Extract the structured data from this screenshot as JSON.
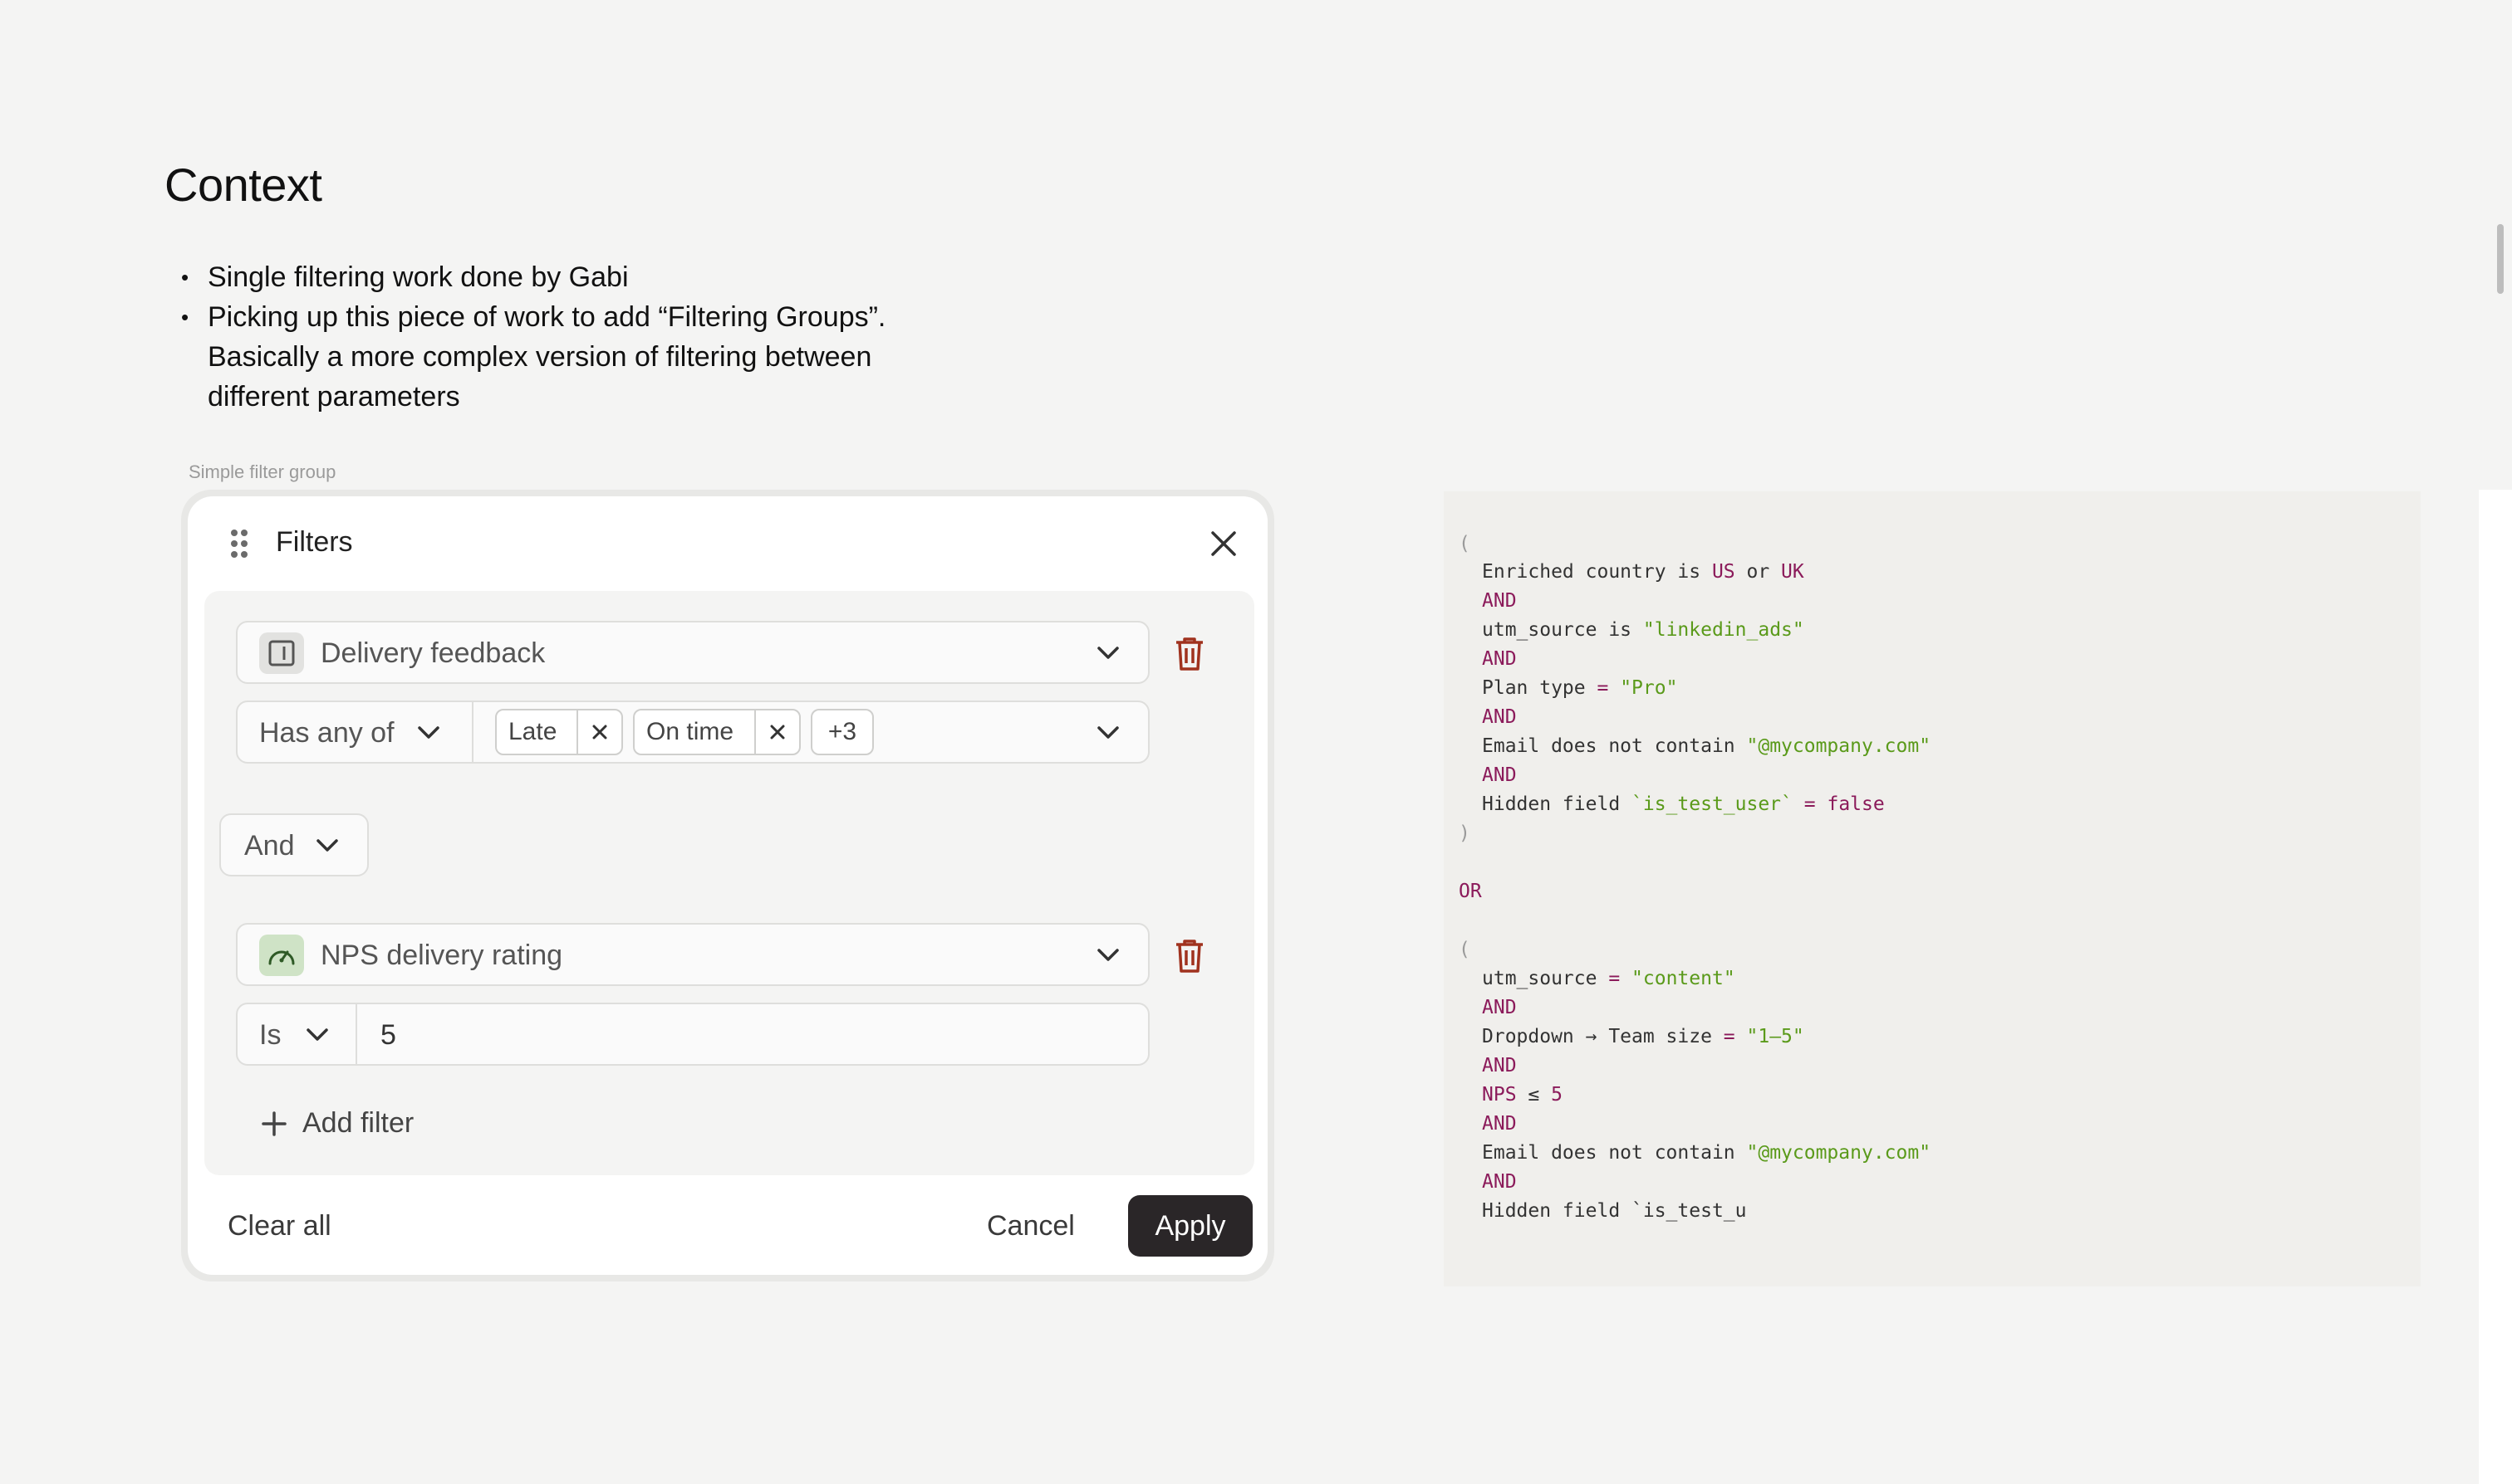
{
  "context": {
    "title": "Context",
    "bullets": [
      "Single filtering work done by Gabi",
      "Picking up this piece of work to add “Filtering Groups”. Basically a more complex version of filtering between different parameters"
    ],
    "group_caption": "Simple filter group"
  },
  "filters_panel": {
    "title": "Filters",
    "icons": {
      "drag": "drag-handle-icon",
      "close": "close-icon",
      "delete": "trash-icon",
      "chevron": "chevron-down-icon",
      "add": "plus-icon"
    },
    "filter1": {
      "field": "Delivery feedback",
      "field_icon": "text-field-icon",
      "operator": "Has any of",
      "tags": [
        "Late",
        "On time"
      ],
      "more": "+3"
    },
    "combinator": "And",
    "filter2": {
      "field": "NPS delivery rating",
      "field_icon": "gauge-icon",
      "operator": "Is",
      "value": "5"
    },
    "add_filter": "Add filter",
    "clear_all": "Clear all",
    "cancel": "Cancel",
    "apply": "Apply"
  },
  "code": {
    "open_paren": "(",
    "close_paren": ")",
    "and": "AND",
    "or": "OR",
    "eq": "=",
    "group1": {
      "l1": {
        "pre": "Enriched country is ",
        "a": "US",
        "mid": " or ",
        "b": "UK"
      },
      "l2": {
        "pre": "utm_source is ",
        "str": "\"linkedin_ads\""
      },
      "l3": {
        "pre": "Plan type ",
        "str": "\"Pro\""
      },
      "l4": {
        "pre": "Email does not contain ",
        "str": "\"@mycompany.com\""
      },
      "l5": {
        "pre": "Hidden field ",
        "str": "`is_test_user`",
        "val": "false"
      }
    },
    "group2": {
      "l1": {
        "pre": "utm_source ",
        "str": "\"content\""
      },
      "l2": {
        "pre": "Dropdown → Team size ",
        "str": "\"1–5\""
      },
      "l3": {
        "kw": "NPS",
        "mid": " ≤ ",
        "val": "5"
      },
      "l4": {
        "pre": "Email does not contain ",
        "str": "\"@mycompany.com\""
      },
      "l5": {
        "pre": "Hidden field `is_test_u"
      }
    }
  },
  "colors": {
    "apply_bg": "#2a2628",
    "delete_red": "#a0321e",
    "keyword": "#8b1a5a",
    "string": "#5a9a1a",
    "gauge_bg": "#cfe3c6"
  }
}
